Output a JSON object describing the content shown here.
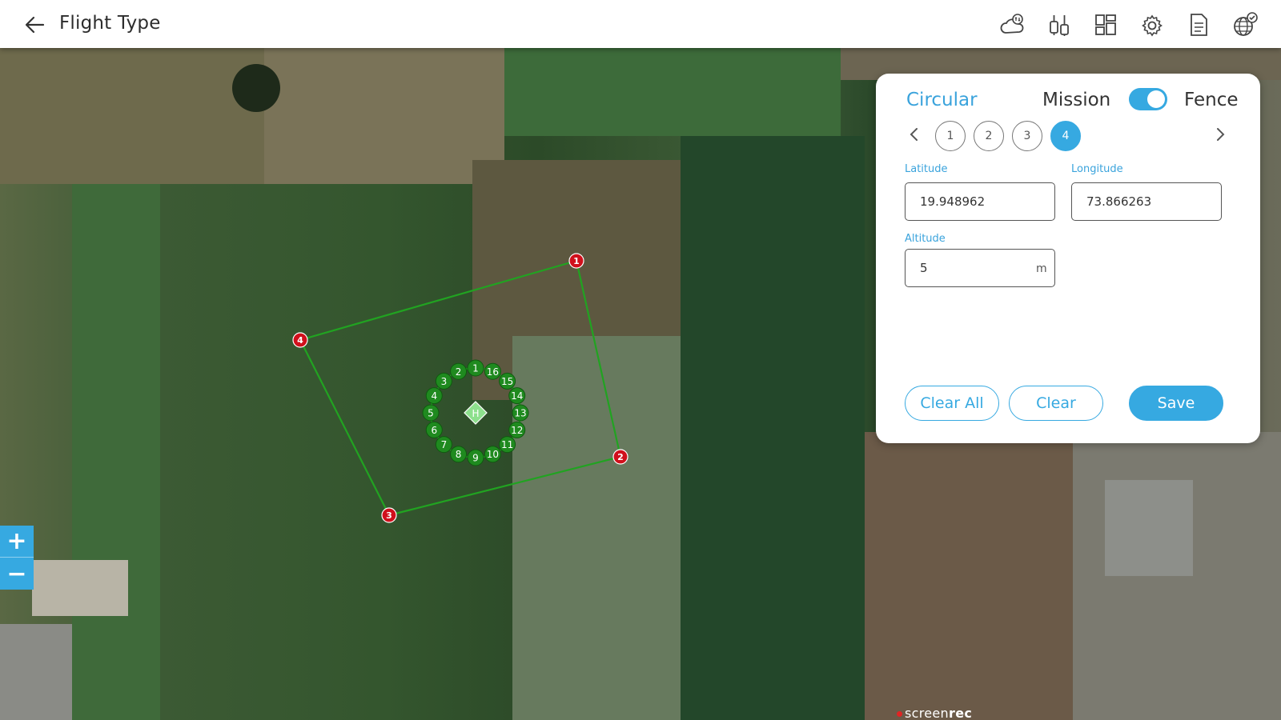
{
  "header": {
    "title": "Flight Type",
    "icons": [
      "back-arrow-icon",
      "weather-sync-icon",
      "controls-icon",
      "layout-icon",
      "settings-icon",
      "document-icon",
      "globe-check-icon"
    ]
  },
  "map": {
    "zoom_in": "+",
    "zoom_out": "−",
    "fence_points": [
      "1",
      "2",
      "3",
      "4"
    ],
    "waypoints": [
      "1",
      "2",
      "3",
      "4",
      "5",
      "6",
      "7",
      "8",
      "9",
      "10",
      "11",
      "12",
      "13",
      "14",
      "15",
      "16"
    ],
    "home_label": "H",
    "watermark": {
      "prefix": "screen",
      "bold": "rec"
    },
    "colors": {
      "fence_marker": "#d0101c",
      "waypoint": "#1f8a1f",
      "path": "#21a321",
      "home": "#8de08d"
    }
  },
  "panel": {
    "type": "Circular",
    "mission_label": "Mission",
    "fence_label": "Fence",
    "toggle_on": true,
    "points": [
      "1",
      "2",
      "3",
      "4"
    ],
    "active_point": "4",
    "latitude": {
      "label": "Latitude",
      "value": "19.948962"
    },
    "longitude": {
      "label": "Longitude",
      "value": "73.866263"
    },
    "altitude": {
      "label": "Altitude",
      "value": "5",
      "unit": "m"
    },
    "buttons": {
      "clear_all": "Clear All",
      "clear": "Clear",
      "save": "Save"
    },
    "accent": "#36a9e1"
  }
}
